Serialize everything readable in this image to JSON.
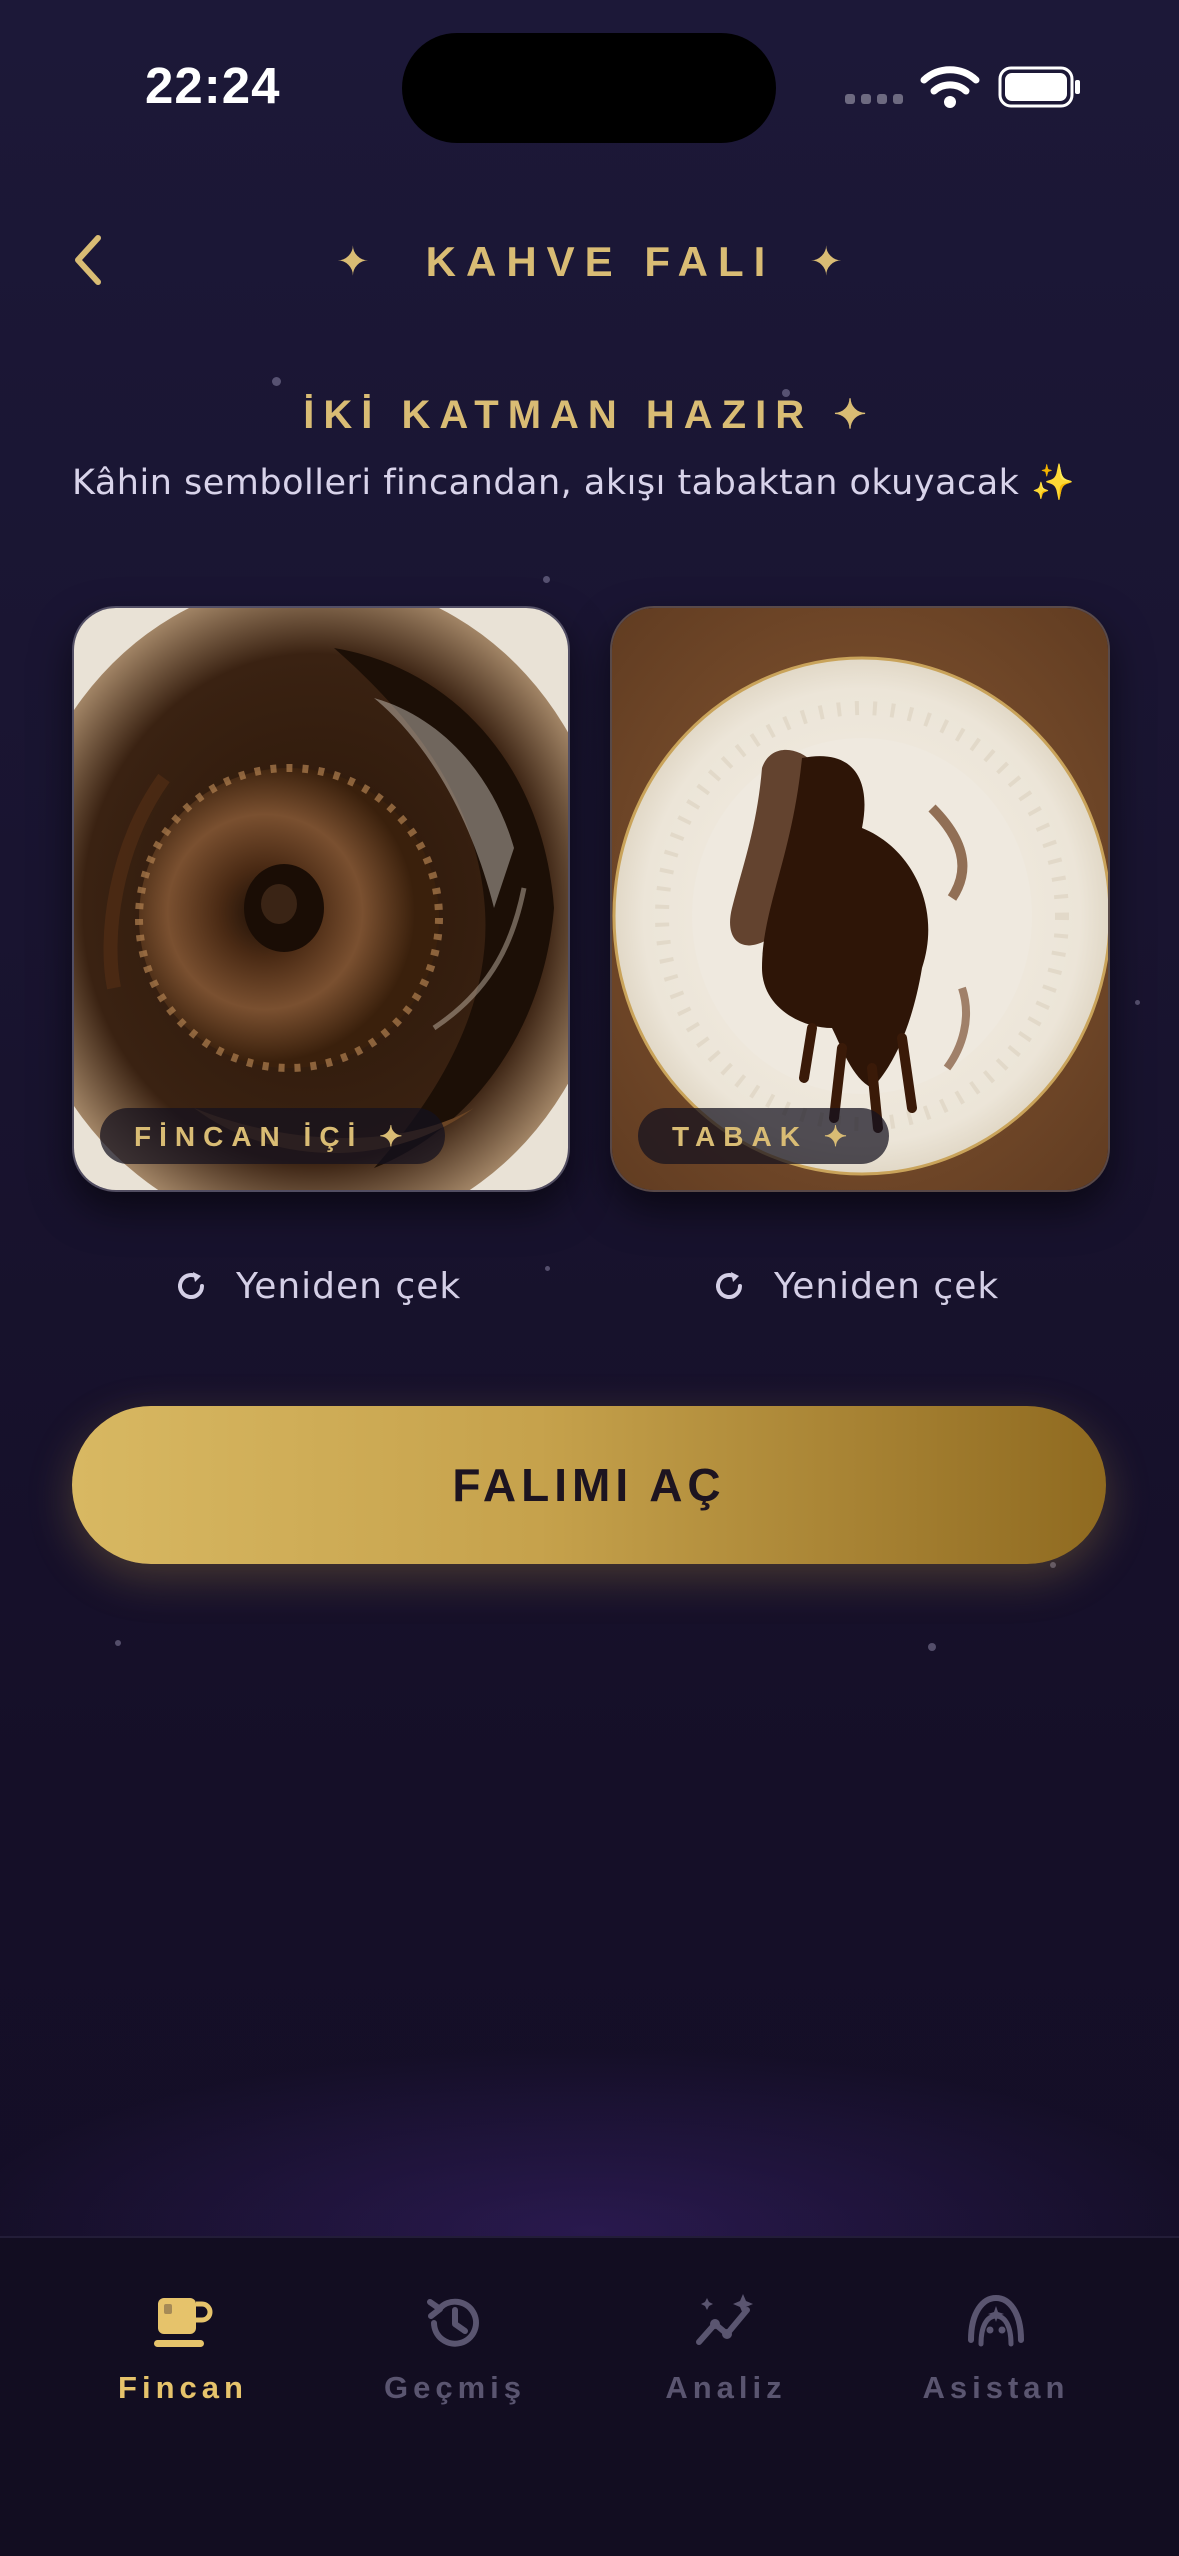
{
  "status_bar": {
    "time": "22:24"
  },
  "header": {
    "title": "KAHVE FALI",
    "title_star": "✦"
  },
  "ready_section": {
    "heading": "İKİ KATMAN HAZIR ✦",
    "description": "Kâhin sembolleri fincandan, akışı tabaktan okuyacak ✨"
  },
  "photos": [
    {
      "label": "FİNCAN İÇİ ✦",
      "retake_label": "Yeniden çek"
    },
    {
      "label": "TABAK ✦",
      "retake_label": "Yeniden çek"
    }
  ],
  "cta": {
    "label": "FALIMI AÇ"
  },
  "tabbar": {
    "active": "Fincan",
    "tabs": [
      {
        "label": "Fincan",
        "icon": "cup-icon"
      },
      {
        "label": "Geçmiş",
        "icon": "history-icon"
      },
      {
        "label": "Analiz",
        "icon": "analytics-icon"
      },
      {
        "label": "Asistan",
        "icon": "assistant-icon"
      }
    ]
  },
  "colors": {
    "accent_gold": "#d9bc74",
    "active_tab": "#e6c36b",
    "inactive_tab": "#5a5570",
    "background": "#191430"
  }
}
